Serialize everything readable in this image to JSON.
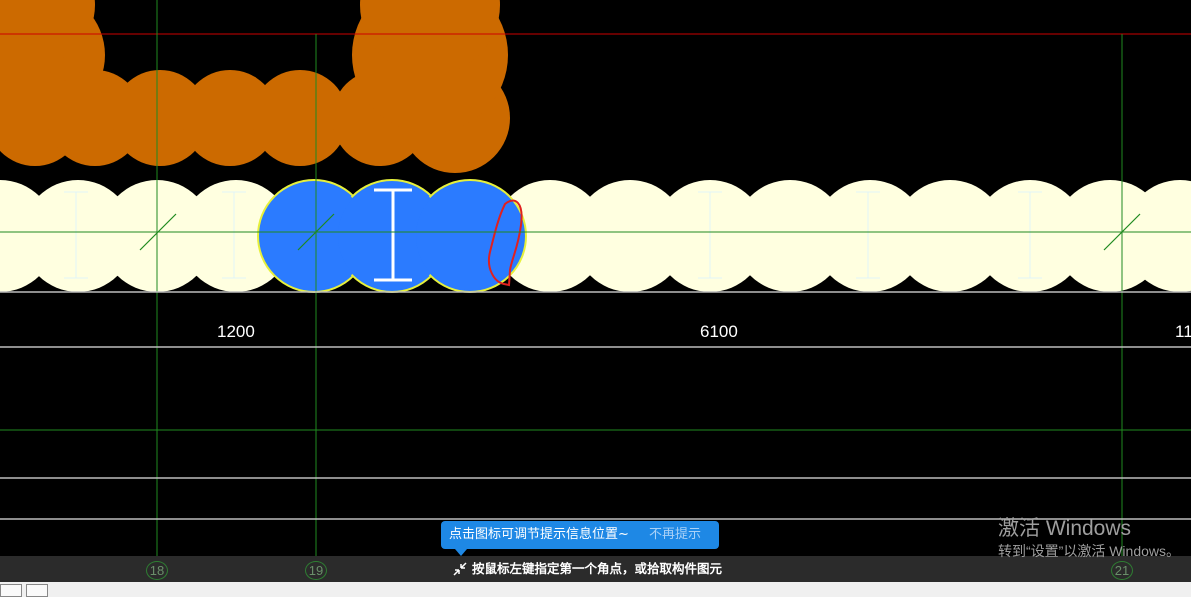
{
  "dimensions": {
    "left_span": "1200",
    "middle_span": "6100",
    "right_span_partial": "11"
  },
  "axes": [
    "18",
    "19",
    "21"
  ],
  "hint": {
    "text": "点击图标可调节提示信息位置~",
    "dismiss_label": "不再提示"
  },
  "command_prompt": "按鼠标左键指定第一个角点，或拾取构件图元",
  "watermark": {
    "title": "激活 Windows",
    "subtitle": "转到“设置”以激活 Windows。"
  },
  "colors": {
    "background": "#000000",
    "orange_member": "#cc6a00",
    "beam_fill": "#ffffe0",
    "selected_fill": "#2b7bff",
    "selected_outline": "#e6f03c",
    "axis_line": "#1f8a1f",
    "red_line": "#cc0000",
    "hint_bg": "#1e88e5"
  }
}
